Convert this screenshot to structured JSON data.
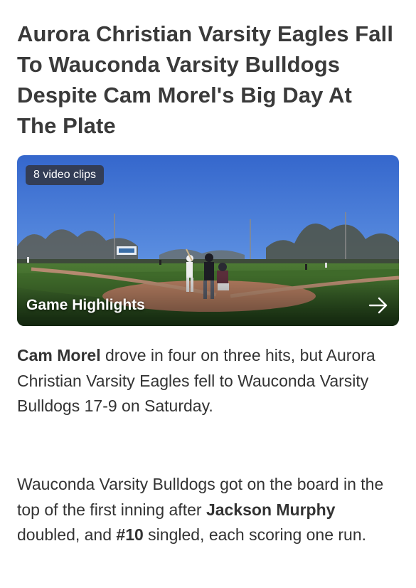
{
  "article": {
    "headline": "Aurora Christian Varsity Eagles Fall To Wauconda Varsity Bulldogs Despite Cam Morel's Big Day At The Plate",
    "video": {
      "clips_badge": "8 video clips",
      "label": "Game Highlights",
      "arrow_icon": "arrow-right-icon"
    },
    "paragraph1": {
      "player": "Cam Morel",
      "text": " drove in four on three hits, but Aurora Christian Varsity Eagles fell to Wauconda Varsity Bulldogs 17-9 on Saturday."
    },
    "paragraph2": {
      "part1": "Wauconda Varsity Bulldogs got on the board in the top of the first inning after ",
      "player1": "Jackson Murphy",
      "part2": " doubled, and ",
      "player2": "#10",
      "part3": " singled, each scoring one run."
    }
  },
  "colors": {
    "text": "#333333",
    "headline": "#3a3a3a",
    "badge_bg": "#323746",
    "sky": "#3f6fd0",
    "grass": "#2f5a1e",
    "infield_dirt": "#b07a5e"
  }
}
